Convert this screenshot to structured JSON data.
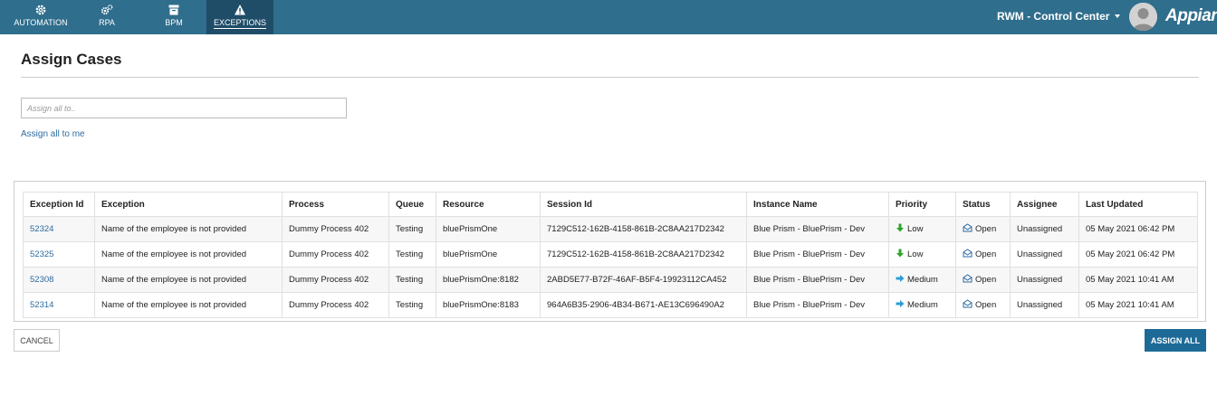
{
  "nav": {
    "tabs": [
      {
        "label": "AUTOMATION",
        "icon": "gear-icon"
      },
      {
        "label": "RPA",
        "icon": "gears-icon"
      },
      {
        "label": "BPM",
        "icon": "archive-icon"
      },
      {
        "label": "EXCEPTIONS",
        "icon": "warning-icon",
        "active": true
      }
    ],
    "site_name": "RWM - Control Center",
    "brand": "Appian"
  },
  "page": {
    "title": "Assign Cases",
    "assign_placeholder": "Assign all to..",
    "assign_value": "",
    "assign_me_label": "Assign all to me"
  },
  "table": {
    "columns": [
      "Exception Id",
      "Exception",
      "Process",
      "Queue",
      "Resource",
      "Session Id",
      "Instance Name",
      "Priority",
      "Status",
      "Assignee",
      "Last Updated"
    ],
    "rows": [
      {
        "id": "52324",
        "exception": "Name of the employee is not provided",
        "process": "Dummy Process 402",
        "queue": "Testing",
        "resource": "bluePrismOne",
        "session": "7129C512-162B-4158-861B-2C8AA217D2342",
        "instance": "Blue Prism - BluePrism - Dev",
        "priority": "Low",
        "priority_icon": "arrow-down-icon",
        "status": "Open",
        "assignee": "Unassigned",
        "updated": "05 May 2021 06:42 PM"
      },
      {
        "id": "52325",
        "exception": "Name of the employee is not provided",
        "process": "Dummy Process 402",
        "queue": "Testing",
        "resource": "bluePrismOne",
        "session": "7129C512-162B-4158-861B-2C8AA217D2342",
        "instance": "Blue Prism - BluePrism - Dev",
        "priority": "Low",
        "priority_icon": "arrow-down-icon",
        "status": "Open",
        "assignee": "Unassigned",
        "updated": "05 May 2021 06:42 PM"
      },
      {
        "id": "52308",
        "exception": "Name of the employee is not provided",
        "process": "Dummy Process 402",
        "queue": "Testing",
        "resource": "bluePrismOne:8182",
        "session": "2ABD5E77-B72F-46AF-B5F4-19923112CA452",
        "instance": "Blue Prism - BluePrism - Dev",
        "priority": "Medium",
        "priority_icon": "arrow-right-icon",
        "status": "Open",
        "assignee": "Unassigned",
        "updated": "05 May 2021 10:41 AM"
      },
      {
        "id": "52314",
        "exception": "Name of the employee is not provided",
        "process": "Dummy Process 402",
        "queue": "Testing",
        "resource": "bluePrismOne:8183",
        "session": "964A6B35-2906-4B34-B671-AE13C696490A2",
        "instance": "Blue Prism - BluePrism - Dev",
        "priority": "Medium",
        "priority_icon": "arrow-right-icon",
        "status": "Open",
        "assignee": "Unassigned",
        "updated": "05 May 2021 10:41 AM"
      }
    ]
  },
  "actions": {
    "cancel_label": "CANCEL",
    "assign_all_label": "ASSIGN ALL"
  },
  "colors": {
    "topbar": "#2f6e8c",
    "active_tab": "#1f4d68",
    "primary_button": "#1d6a96",
    "link": "#2c6aa0",
    "priority_low": "#2aa52a",
    "priority_medium": "#2a9fd6"
  }
}
